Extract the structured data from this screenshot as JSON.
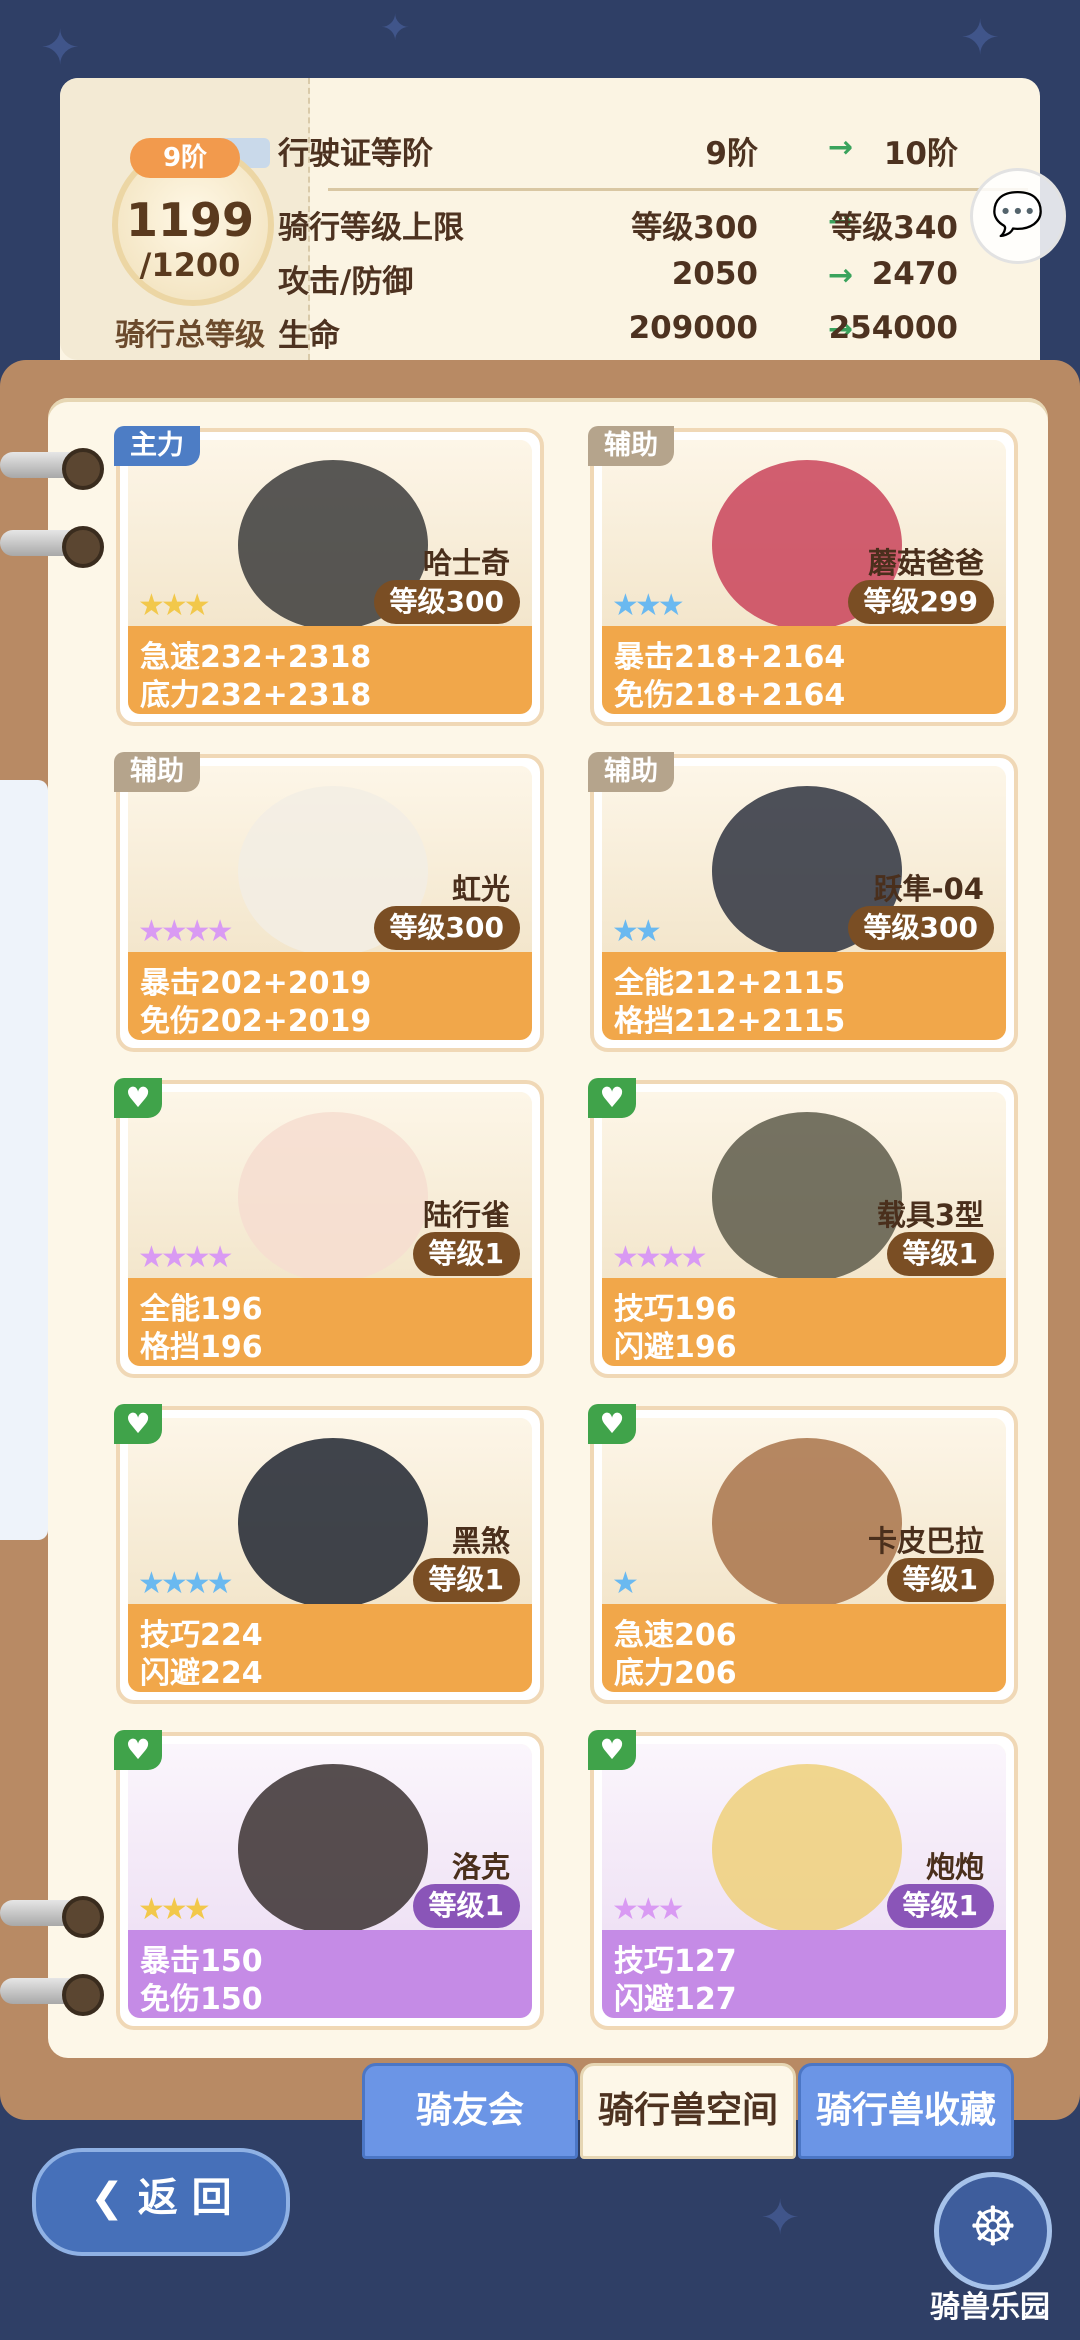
{
  "rank": {
    "tier_label": "9阶",
    "level": "1199",
    "level_max": "/1200",
    "caption": "骑行总等级"
  },
  "stats_table": [
    {
      "label": "行驶证等阶",
      "current": "9阶",
      "next": "10阶"
    },
    {
      "label": "骑行等级上限",
      "current": "等级300",
      "next": "等级340"
    },
    {
      "label": "攻击/防御",
      "current": "2050",
      "next": "2470"
    },
    {
      "label": "生命",
      "current": "209000",
      "next": "254000"
    }
  ],
  "arrow_icon": "→",
  "cards": [
    {
      "tag": "主力",
      "tag_type": "main",
      "name": "哈士奇",
      "level": "等级300",
      "stars": "★★★",
      "star_color": "gold",
      "stat1": "急速232+2318",
      "stat2": "底力232+2318",
      "rarity": "orange",
      "art_color": "#3b3b3b"
    },
    {
      "tag": "辅助",
      "tag_type": "sub",
      "name": "蘑菇爸爸",
      "level": "等级299",
      "stars": "★★★",
      "star_color": "blue",
      "stat1": "暴击218+2164",
      "stat2": "免伤218+2164",
      "rarity": "orange",
      "art_color": "#c9435a"
    },
    {
      "tag": "辅助",
      "tag_type": "sub",
      "name": "虹光",
      "level": "等级300",
      "stars": "★★★★",
      "star_color": "pink",
      "stat1": "暴击202+2019",
      "stat2": "免伤202+2019",
      "rarity": "orange",
      "art_color": "#f2ede4"
    },
    {
      "tag": "辅助",
      "tag_type": "sub",
      "name": "跃隼-04",
      "level": "等级300",
      "stars": "★★",
      "star_color": "blue",
      "stat1": "全能212+2115",
      "stat2": "格挡212+2115",
      "rarity": "orange",
      "art_color": "#2e3340"
    },
    {
      "tag": "♥",
      "tag_type": "heart",
      "name": "陆行雀",
      "level": "等级1",
      "stars": "★★★★",
      "star_color": "pink",
      "stat1": "全能196",
      "stat2": "格挡196",
      "rarity": "orange",
      "art_color": "#f6ddd0"
    },
    {
      "tag": "♥",
      "tag_type": "heart",
      "name": "载具3型",
      "level": "等级1",
      "stars": "★★★★",
      "star_color": "pink",
      "stat1": "技巧196",
      "stat2": "闪避196",
      "rarity": "orange",
      "art_color": "#5d5a4a"
    },
    {
      "tag": "♥",
      "tag_type": "heart",
      "name": "黑煞",
      "level": "等级1",
      "stars": "★★★★",
      "star_color": "blue",
      "stat1": "技巧224",
      "stat2": "闪避224",
      "rarity": "orange",
      "art_color": "#1f2430"
    },
    {
      "tag": "♥",
      "tag_type": "heart",
      "name": "卡皮巴拉",
      "level": "等级1",
      "stars": "★",
      "star_color": "blue",
      "stat1": "急速206",
      "stat2": "底力206",
      "rarity": "orange",
      "art_color": "#a8734a"
    },
    {
      "tag": "♥",
      "tag_type": "heart",
      "name": "洛克",
      "level": "等级1",
      "stars": "★★★",
      "star_color": "gold",
      "stat1": "暴击150",
      "stat2": "免伤150",
      "rarity": "purple",
      "art_color": "#3a3030"
    },
    {
      "tag": "♥",
      "tag_type": "heart",
      "name": "炮炮",
      "level": "等级1",
      "stars": "★★★",
      "star_color": "pink",
      "stat1": "技巧127",
      "stat2": "闪避127",
      "rarity": "purple",
      "art_color": "#efd07a"
    }
  ],
  "tabs": [
    "骑友会",
    "骑行兽空间",
    "骑行兽收藏"
  ],
  "back_label": "返 回",
  "park_label": "骑兽乐园",
  "icons": {
    "chat": "chat-bubble-icon",
    "back": "back-arrow-icon",
    "park": "ferris-wheel-icon"
  }
}
